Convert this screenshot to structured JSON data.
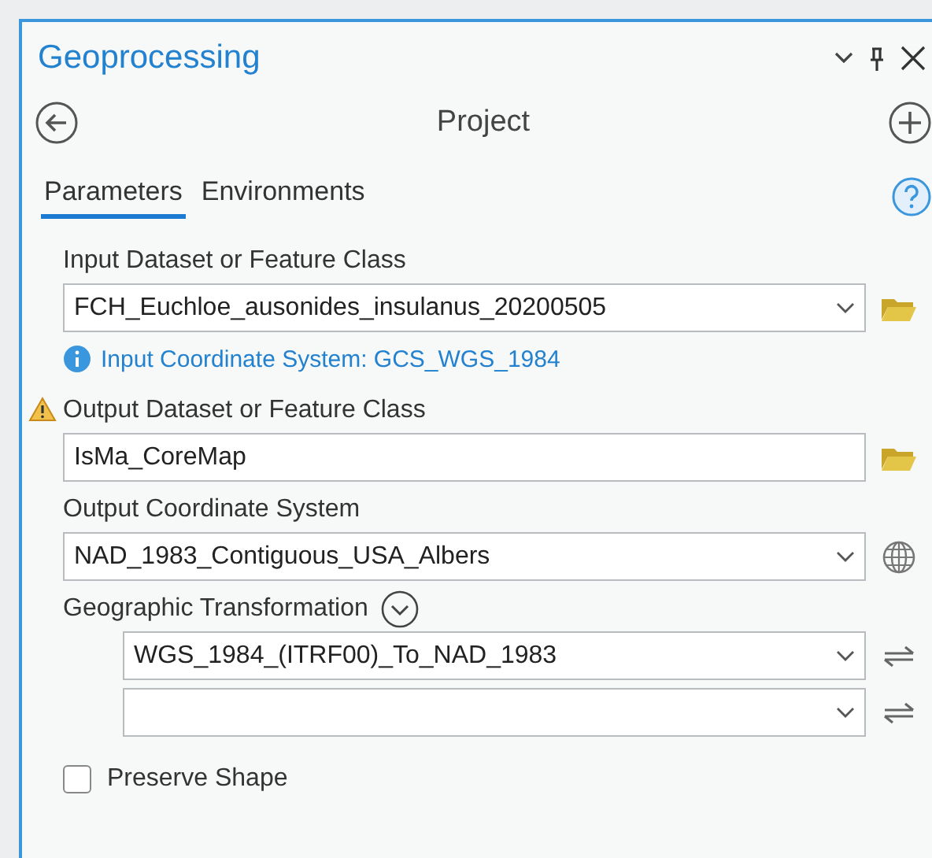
{
  "panel": {
    "title": "Geoprocessing",
    "tool_name": "Project"
  },
  "tabs": [
    {
      "label": "Parameters",
      "selected": true
    },
    {
      "label": "Environments",
      "selected": false
    }
  ],
  "parameters": [
    {
      "kind": "combo",
      "label": "Input Dataset or Feature Class",
      "value": "FCH_Euchloe_ausonides_insulanus_20200505",
      "action": {
        "kind": "folder"
      },
      "warning": false
    },
    {
      "kind": "info",
      "text": "Input Coordinate System: GCS_WGS_1984"
    },
    {
      "kind": "text",
      "label": "Output Dataset or Feature Class",
      "value": "IsMa_CoreMap",
      "action": {
        "kind": "folder"
      },
      "warning": true
    },
    {
      "kind": "combo",
      "label": "Output Coordinate System",
      "value": "NAD_1983_Contiguous_USA_Albers",
      "action": {
        "kind": "globe"
      },
      "warning": false
    },
    {
      "kind": "group",
      "label": "Geographic Transformation",
      "expanded": true,
      "rows": [
        {
          "value": "WGS_1984_(ITRF00)_To_NAD_1983"
        },
        {}
      ]
    },
    {
      "kind": "checkbox",
      "label": "Preserve Shape",
      "checked": false
    }
  ]
}
